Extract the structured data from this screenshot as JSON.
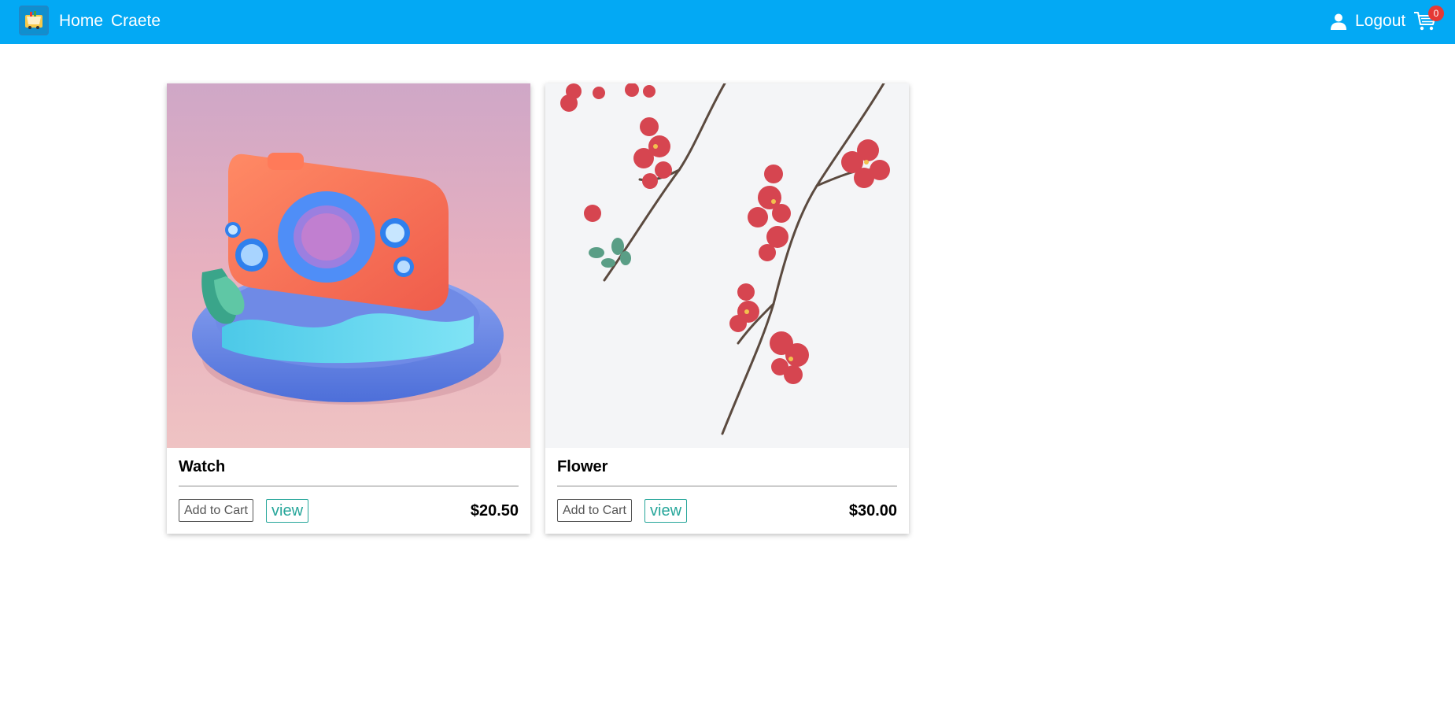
{
  "navbar": {
    "logo_icon": "shop-cart-logo-icon",
    "home_label": "Home",
    "create_label": "Craete",
    "user_icon": "user-icon",
    "logout_label": "Logout",
    "cart_icon": "shopping-cart-icon",
    "cart_count": "0",
    "bg_color": "#03a9f4"
  },
  "products": [
    {
      "title": "Watch",
      "image": "3d-camera-illustration",
      "add_to_cart_label": "Add to Cart",
      "view_label": "view",
      "price": "$20.50"
    },
    {
      "title": "Flower",
      "image": "red-blossom-branches",
      "add_to_cart_label": "Add to Cart",
      "view_label": "view",
      "price": "$30.00"
    }
  ]
}
